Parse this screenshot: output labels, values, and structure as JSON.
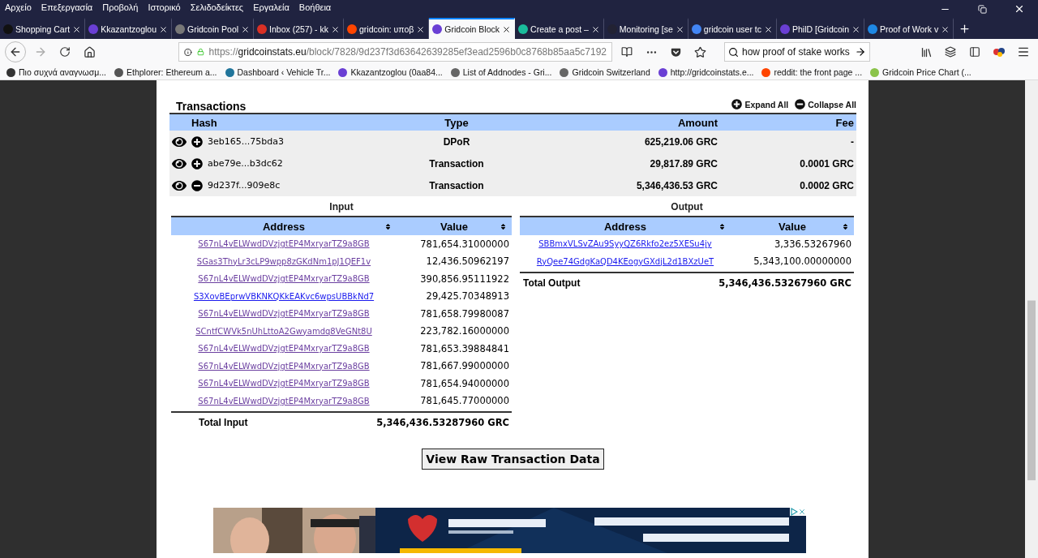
{
  "menu": [
    "Αρχείο",
    "Επεξεργασία",
    "Προβολή",
    "Ιστορικό",
    "Σελιδοδείκτες",
    "Εργαλεία",
    "Βοήθεια"
  ],
  "tabs": [
    {
      "label": "Shopping Cart",
      "selected": false,
      "color": "#111111"
    },
    {
      "label": "Kkazantzoglou",
      "selected": false,
      "color": "#6a3fd4"
    },
    {
      "label": "Gridcoin Pool",
      "selected": false,
      "color": "#777777"
    },
    {
      "label": "Inbox (257) - kk",
      "selected": false,
      "color": "#d93025"
    },
    {
      "label": "gridcoin: υποβ",
      "selected": false,
      "color": "#ff4500"
    },
    {
      "label": "Gridcoin Block",
      "selected": true,
      "color": "#6a3fd4"
    },
    {
      "label": "Create a post –",
      "selected": false,
      "color": "#1abc9c"
    },
    {
      "label": "Monitoring [se",
      "selected": false,
      "color": "#222233"
    },
    {
      "label": "gridcoin user tc",
      "selected": false,
      "color": "#4285f4"
    },
    {
      "label": "PhilD [Gridcoin",
      "selected": false,
      "color": "#6a3fd4"
    },
    {
      "label": "Proof of Work v",
      "selected": false,
      "color": "#1e88e5"
    }
  ],
  "url": {
    "scheme": "https://",
    "domain": "gridcoinstats.eu",
    "path": "/block/7828/9d237f3d63642639285ef3ead2596b0c8768b85aa5c7192"
  },
  "search": {
    "value": "how proof of stake works"
  },
  "bookmarks": [
    {
      "label": "Πιο συχνά αναγνωσμ...",
      "color": "#333333"
    },
    {
      "label": "Ethplorer: Ethereum a...",
      "color": "#555555"
    },
    {
      "label": "Dashboard ‹ Vehicle Tr...",
      "color": "#21759b"
    },
    {
      "label": "Kkazantzoglou (0aa84...",
      "color": "#6a3fd4"
    },
    {
      "label": "List of Addnodes - Gri...",
      "color": "#666666"
    },
    {
      "label": "Gridcoin Switzerland",
      "color": "#666666"
    },
    {
      "label": "http://gridcoinstats.e...",
      "color": "#6a3fd4"
    },
    {
      "label": "reddit: the front page ...",
      "color": "#ff4500"
    },
    {
      "label": "Gridcoin Price Chart (...",
      "color": "#8bc34a"
    }
  ],
  "transactions": {
    "title": "Transactions",
    "expand_all": "Expand All",
    "collapse_all": "Collapse All",
    "columns": [
      "Hash",
      "Type",
      "Amount",
      "Fee"
    ],
    "rows": [
      {
        "hash": "3eb165...75bda3",
        "type": "DPoR",
        "amount": "625,219.06 GRC",
        "fee": "-",
        "expanded": false
      },
      {
        "hash": "abe79e...b3dc62",
        "type": "Transaction",
        "amount": "29,817.89 GRC",
        "fee": "0.0001 GRC",
        "expanded": false
      },
      {
        "hash": "9d237f...909e8c",
        "type": "Transaction",
        "amount": "5,346,436.53 GRC",
        "fee": "0.0002 GRC",
        "expanded": true
      }
    ]
  },
  "input": {
    "title": "Input",
    "columns": [
      "Address",
      "Value"
    ],
    "rows": [
      {
        "address": "S67nL4vELWwdDVzjgtEP4MxryarTZ9a8GB",
        "value": "781,654.31000000",
        "visited": true
      },
      {
        "address": "SGas3ThyLr3cLP9wpp8zGKdNm1pJ1QEF1v",
        "value": "12,436.50962197",
        "visited": true
      },
      {
        "address": "S67nL4vELWwdDVzjgtEP4MxryarTZ9a8GB",
        "value": "390,856.95111922",
        "visited": true
      },
      {
        "address": "S3XovBEprwVBKNKQKkEAKvc6wpsUBBkNd7",
        "value": "29,425.70348913",
        "visited": false
      },
      {
        "address": "S67nL4vELWwdDVzjgtEP4MxryarTZ9a8GB",
        "value": "781,658.79980087",
        "visited": true
      },
      {
        "address": "SCntfCWVk5nUhLttoA2Gwyamdq8VeGNt8U",
        "value": "223,782.16000000",
        "visited": true
      },
      {
        "address": "S67nL4vELWwdDVzjgtEP4MxryarTZ9a8GB",
        "value": "781,653.39884841",
        "visited": true
      },
      {
        "address": "S67nL4vELWwdDVzjgtEP4MxryarTZ9a8GB",
        "value": "781,667.99000000",
        "visited": true
      },
      {
        "address": "S67nL4vELWwdDVzjgtEP4MxryarTZ9a8GB",
        "value": "781,654.94000000",
        "visited": true
      },
      {
        "address": "S67nL4vELWwdDVzjgtEP4MxryarTZ9a8GB",
        "value": "781,645.77000000",
        "visited": true
      }
    ],
    "total_label": "Total Input",
    "total": "5,346,436.53287960 GRC"
  },
  "output": {
    "title": "Output",
    "columns": [
      "Address",
      "Value"
    ],
    "rows": [
      {
        "address": "SBBmxVLSvZAu9SyyQZ6Rkfo2ez5XESu4jy",
        "value": "3,336.53267960",
        "visited": false
      },
      {
        "address": "RyQee74GdgKaQD4KEogyGXdjL2d1BXzUeT",
        "value": "5,343,100.00000000",
        "visited": false
      }
    ],
    "total_label": "Total Output",
    "total": "5,346,436.53267960 GRC"
  },
  "raw_button": "View Raw Transaction Data"
}
